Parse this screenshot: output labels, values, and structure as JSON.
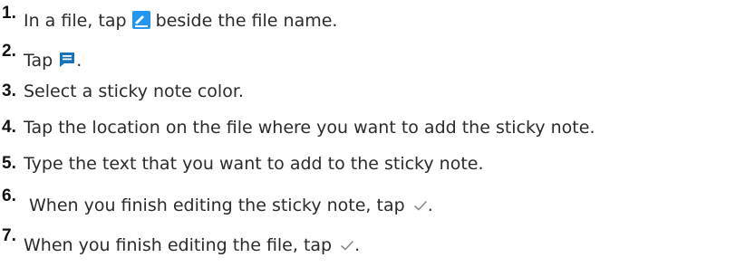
{
  "steps": [
    {
      "number": "1.",
      "text_before": "In a file, tap ",
      "icon": "edit-pen-icon",
      "text_after": " beside the file name."
    },
    {
      "number": "2.",
      "text_before": "Tap ",
      "icon": "sticky-note-icon",
      "text_after": "."
    },
    {
      "number": "3.",
      "text": "Select a sticky note color."
    },
    {
      "number": "4.",
      "text": "Tap the location on the file where you want to add the sticky note."
    },
    {
      "number": "5.",
      "text": "Type the text that you want to add to the sticky note."
    },
    {
      "number": "6.",
      "text_before": "When you finish editing the sticky note, tap ",
      "icon": "checkmark-icon",
      "text_after": "."
    },
    {
      "number": "7.",
      "text_before": "When you finish editing the file, tap ",
      "icon": "checkmark-icon",
      "text_after": "."
    }
  ],
  "colors": {
    "edit_icon_blue": "#2196f3",
    "sticky_icon_blue": "#1a73b8",
    "check_gray": "#8a8a8a",
    "number_black": "#111111",
    "text": "#2b2b2b"
  }
}
